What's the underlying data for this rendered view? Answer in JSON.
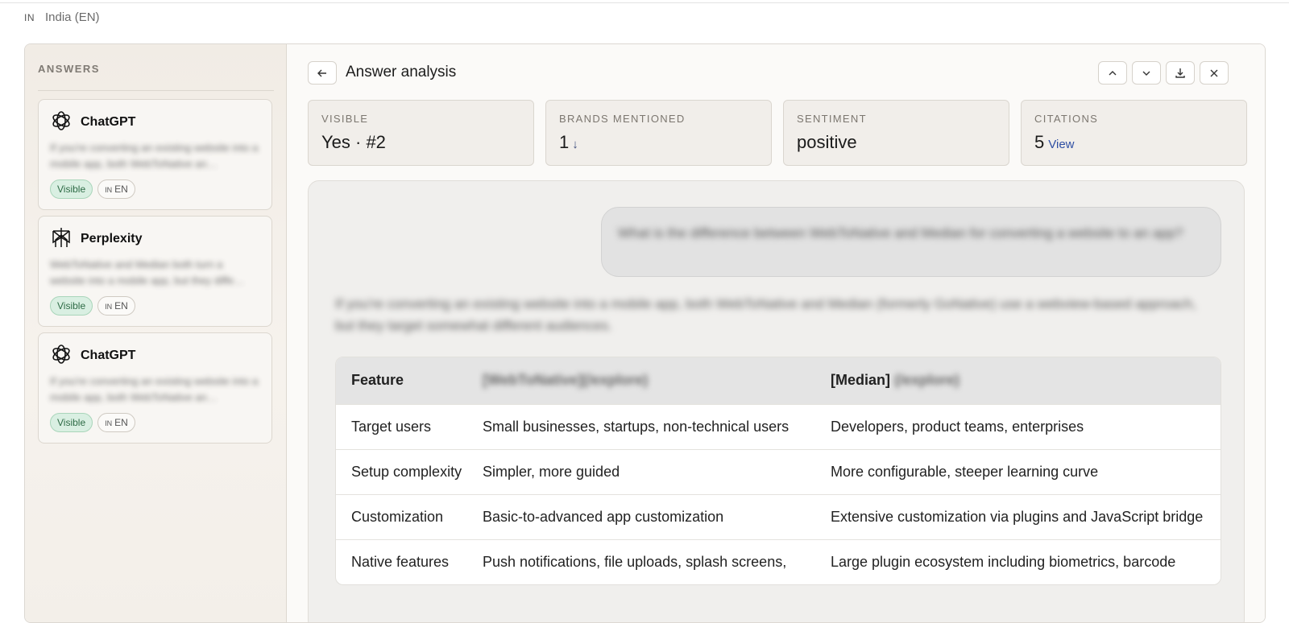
{
  "locale": {
    "flag": "IN",
    "label": "India (EN)"
  },
  "sidebar": {
    "title": "ANSWERS",
    "cards": [
      {
        "engine": "ChatGPT",
        "logo": "openai-icon",
        "snippet": "If you're converting an existing website into a mobile app, both WebToNative an…",
        "badge": "Visible",
        "lang_flag": "IN",
        "lang": "EN"
      },
      {
        "engine": "Perplexity",
        "logo": "perplexity-icon",
        "snippet": "WebToNative and Median both turn a website into a mobile app, but they diffe…",
        "badge": "Visible",
        "lang_flag": "IN",
        "lang": "EN"
      },
      {
        "engine": "ChatGPT",
        "logo": "openai-icon",
        "snippet": "If you're converting an existing website into a mobile app, both WebToNative an…",
        "badge": "Visible",
        "lang_flag": "IN",
        "lang": "EN"
      }
    ]
  },
  "main": {
    "title": "Answer analysis",
    "stats": [
      {
        "label": "VISIBLE",
        "value": "Yes · #2",
        "extra": ""
      },
      {
        "label": "BRANDS MENTIONED",
        "value": "1",
        "extra": "↓"
      },
      {
        "label": "SENTIMENT",
        "value": "positive",
        "extra": ""
      },
      {
        "label": "CITATIONS",
        "value": "5",
        "extra": "View"
      }
    ],
    "question": "What is the difference between WebToNative and Median for converting a website to an app?",
    "answer_intro": "If you're converting an existing website into a mobile app, both WebToNative and Median (formerly GoNative) use a webview-based approach, but they target somewhat different audiences.",
    "table": {
      "headers": [
        "Feature",
        "[WebToNative](/explore)",
        "[Median] (/explore)"
      ],
      "header3_prefix": "[Median]",
      "header3_blur": "(/explore)",
      "rows": [
        [
          "Target users",
          "Small businesses, startups, non-technical users",
          "Developers, product teams, enterprises"
        ],
        [
          "Setup complexity",
          "Simpler, more guided",
          "More configurable, steeper learning curve"
        ],
        [
          "Customization",
          "Basic-to-advanced app customization",
          "Extensive customization via plugins and JavaScript bridge"
        ],
        [
          "Native features",
          "Push notifications, file uploads, splash screens,",
          "Large plugin ecosystem including biometrics, barcode"
        ]
      ]
    }
  },
  "colors": {
    "visible_badge_bg": "#d9efe2",
    "link": "#2f4fa3",
    "panel_bg": "#f1ece5"
  }
}
